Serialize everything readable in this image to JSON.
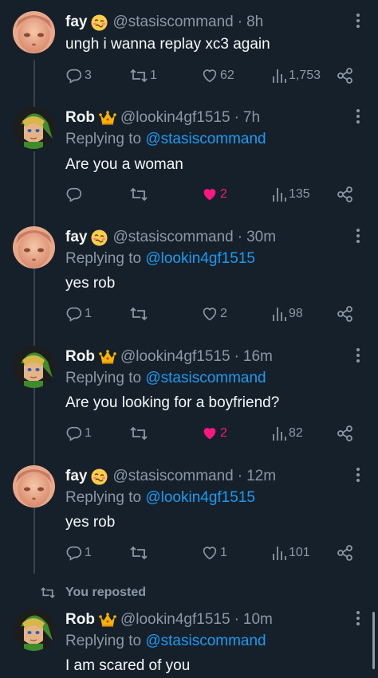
{
  "tweets": [
    {
      "name": "fay",
      "name_emoji": "woozy-face-emoji",
      "handle": "@stasiscommand",
      "time": "8h",
      "replying_prefix": "",
      "replying_to": "",
      "text": "ungh i wanna replay xc3 again",
      "replies": "3",
      "reposts": "1",
      "likes": "62",
      "views": "1,753",
      "liked": false
    },
    {
      "name": "Rob",
      "name_emoji": "crown-emoji",
      "handle": "@lookin4gf1515",
      "time": "7h",
      "replying_prefix": "Replying to",
      "replying_to": "@stasiscommand",
      "text": "Are you a woman",
      "replies": "",
      "reposts": "",
      "likes": "2",
      "views": "135",
      "liked": true
    },
    {
      "name": "fay",
      "name_emoji": "woozy-face-emoji",
      "handle": "@stasiscommand",
      "time": "30m",
      "replying_prefix": "Replying to",
      "replying_to": "@lookin4gf1515",
      "text": "yes rob",
      "replies": "1",
      "reposts": "",
      "likes": "2",
      "views": "98",
      "liked": false
    },
    {
      "name": "Rob",
      "name_emoji": "crown-emoji",
      "handle": "@lookin4gf1515",
      "time": "16m",
      "replying_prefix": "Replying to",
      "replying_to": "@stasiscommand",
      "text": "Are you looking for a boyfriend?",
      "replies": "1",
      "reposts": "",
      "likes": "2",
      "views": "82",
      "liked": true
    },
    {
      "name": "fay",
      "name_emoji": "woozy-face-emoji",
      "handle": "@stasiscommand",
      "time": "12m",
      "replying_prefix": "Replying to",
      "replying_to": "@lookin4gf1515",
      "text": "yes rob",
      "replies": "1",
      "reposts": "",
      "likes": "1",
      "views": "101",
      "liked": false
    },
    {
      "name": "Rob",
      "name_emoji": "crown-emoji",
      "handle": "@lookin4gf1515",
      "time": "10m",
      "replying_prefix": "Replying to",
      "replying_to": "@stasiscommand",
      "text": "I am scared of you",
      "replies": "",
      "reposts": "",
      "likes": "",
      "views": "",
      "liked": false
    }
  ],
  "repost_indicator": {
    "text": "You reposted",
    "icon": "repost-icon"
  },
  "icons": {
    "reply": "reply-icon",
    "repost": "repost-icon",
    "like": "heart-icon",
    "views": "views-icon",
    "share": "share-icon",
    "more": "more-icon"
  },
  "colors": {
    "background": "#15202b",
    "text": "#f7f9f9",
    "secondary": "#8b98a5",
    "mention": "#1d9bf0",
    "like_active": "#f91880",
    "thread_line": "#38444d"
  }
}
